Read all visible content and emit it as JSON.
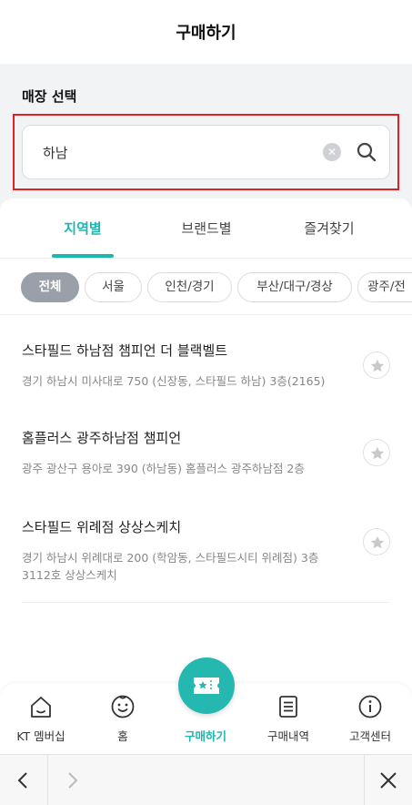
{
  "header": {
    "title": "구매하기"
  },
  "store_select": {
    "title": "매장 선택",
    "search_value": "하남",
    "clear_icon": "clear-circle-icon",
    "search_icon": "magnifier-icon"
  },
  "tabs": [
    {
      "label": "지역별",
      "active": true
    },
    {
      "label": "브랜드별",
      "active": false
    },
    {
      "label": "즐겨찾기",
      "active": false
    }
  ],
  "region_chips": [
    {
      "label": "전체",
      "active": true
    },
    {
      "label": "서울",
      "active": false
    },
    {
      "label": "인천/경기",
      "active": false
    },
    {
      "label": "부산/대구/경상",
      "active": false
    },
    {
      "label": "광주/전",
      "active": false
    }
  ],
  "stores": [
    {
      "name": "스타필드 하남점 챔피언 더 블랙벨트",
      "address": "경기 하남시 미사대로 750 (신장동, 스타필드 하남) 3층(2165)",
      "favorite": false
    },
    {
      "name": "홈플러스 광주하남점 챔피언",
      "address": "광주 광산구 용아로 390 (하남동) 홈플러스 광주하남점 2층",
      "favorite": false
    },
    {
      "name": "스타필드 위례점 상상스케치",
      "address": "경기 하남시 위례대로 200 (학암동, 스타필드시티 위례점) 3층 3112호 상상스케치",
      "favorite": false
    }
  ],
  "bottom_nav": [
    {
      "label": "KT 멤버십",
      "icon": "home-icon",
      "active": false
    },
    {
      "label": "홈",
      "icon": "smile-icon",
      "active": false
    },
    {
      "label": "구매하기",
      "icon": "ticket-icon",
      "active": true
    },
    {
      "label": "구매내역",
      "icon": "receipt-icon",
      "active": false
    },
    {
      "label": "고객센터",
      "icon": "info-icon",
      "active": false
    }
  ],
  "browser_bar": {
    "back_icon": "chevron-left-icon",
    "forward_icon": "chevron-right-icon",
    "close_icon": "close-icon"
  },
  "colors": {
    "accent": "#1eb6b0",
    "highlight_border": "#e01f26",
    "chip_active": "#9aa0aa"
  }
}
